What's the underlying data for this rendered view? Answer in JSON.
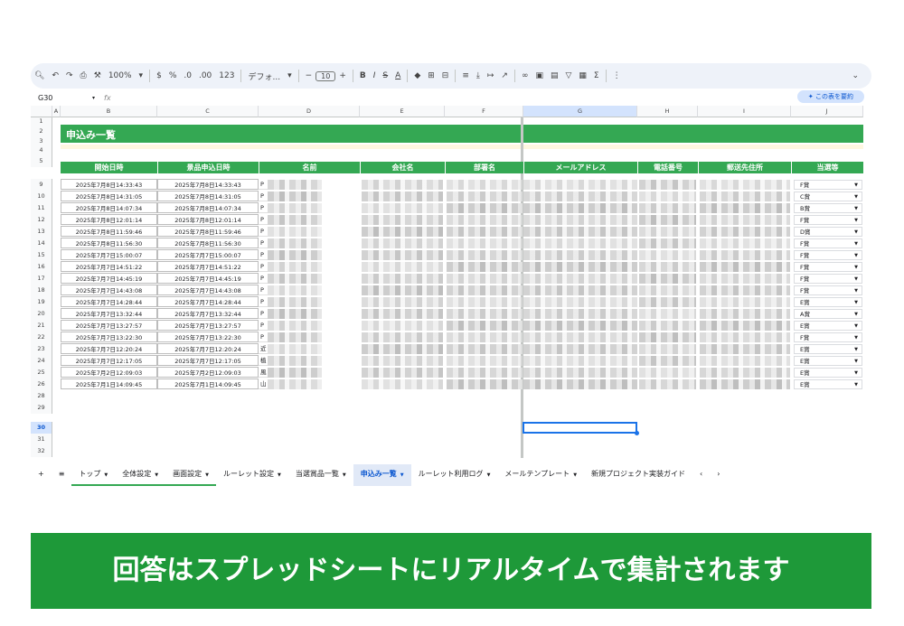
{
  "toolbar": {
    "zoom": "100%",
    "currency": "$",
    "percent": "%",
    "dec_decrease": ".0",
    "dec_increase": ".00",
    "number_format": "123",
    "font": "デフォ...",
    "font_size": "10"
  },
  "formula_bar": {
    "cell_ref": "G30",
    "fx": "fx",
    "summarize_label": "この表を要約"
  },
  "columns": [
    "A",
    "B",
    "C",
    "D",
    "E",
    "F",
    "G",
    "H",
    "I",
    "J"
  ],
  "sheet_title": "申込み一覧",
  "headers": [
    "開始日時",
    "景品申込日時",
    "名前",
    "会社名",
    "部署名",
    "メールアドレス",
    "電話番号",
    "郵送先住所",
    "当選等"
  ],
  "row_numbers": [
    "1",
    "2",
    "3",
    "4",
    "5",
    "9",
    "10",
    "11",
    "12",
    "13",
    "14",
    "15",
    "16",
    "17",
    "18",
    "19",
    "20",
    "21",
    "22",
    "23",
    "24",
    "25",
    "26",
    "28",
    "29",
    "30",
    "31",
    "32"
  ],
  "rows": [
    {
      "start": "2025年7月8日14:33:43",
      "applied": "2025年7月8日14:33:43",
      "name_initial": "P",
      "prize": "F賞"
    },
    {
      "start": "2025年7月8日14:31:05",
      "applied": "2025年7月8日14:31:05",
      "name_initial": "P",
      "prize": "C賞"
    },
    {
      "start": "2025年7月8日14:07:34",
      "applied": "2025年7月8日14:07:34",
      "name_initial": "P",
      "prize": "B賞"
    },
    {
      "start": "2025年7月8日12:01:14",
      "applied": "2025年7月8日12:01:14",
      "name_initial": "P",
      "prize": "F賞"
    },
    {
      "start": "2025年7月8日11:59:46",
      "applied": "2025年7月8日11:59:46",
      "name_initial": "P",
      "prize": "D賞"
    },
    {
      "start": "2025年7月8日11:56:30",
      "applied": "2025年7月8日11:56:30",
      "name_initial": "P",
      "prize": "F賞"
    },
    {
      "start": "2025年7月7日15:00:07",
      "applied": "2025年7月7日15:00:07",
      "name_initial": "P",
      "prize": "F賞"
    },
    {
      "start": "2025年7月7日14:51:22",
      "applied": "2025年7月7日14:51:22",
      "name_initial": "P",
      "prize": "F賞"
    },
    {
      "start": "2025年7月7日14:45:19",
      "applied": "2025年7月7日14:45:19",
      "name_initial": "P",
      "prize": "F賞"
    },
    {
      "start": "2025年7月7日14:43:08",
      "applied": "2025年7月7日14:43:08",
      "name_initial": "P",
      "prize": "F賞"
    },
    {
      "start": "2025年7月7日14:28:44",
      "applied": "2025年7月7日14:28:44",
      "name_initial": "P",
      "prize": "E賞"
    },
    {
      "start": "2025年7月7日13:32:44",
      "applied": "2025年7月7日13:32:44",
      "name_initial": "P",
      "prize": "A賞"
    },
    {
      "start": "2025年7月7日13:27:57",
      "applied": "2025年7月7日13:27:57",
      "name_initial": "P",
      "prize": "E賞"
    },
    {
      "start": "2025年7月7日13:22:30",
      "applied": "2025年7月7日13:22:30",
      "name_initial": "P",
      "prize": "F賞"
    },
    {
      "start": "2025年7月7日12:20:24",
      "applied": "2025年7月7日12:20:24",
      "name_initial": "近",
      "prize": "E賞"
    },
    {
      "start": "2025年7月7日12:17:05",
      "applied": "2025年7月7日12:17:05",
      "name_initial": "植",
      "prize": "E賞"
    },
    {
      "start": "2025年7月2日12:09:03",
      "applied": "2025年7月2日12:09:03",
      "name_initial": "風",
      "prize": "E賞"
    },
    {
      "start": "2025年7月1日14:09:45",
      "applied": "2025年7月1日14:09:45",
      "name_initial": "山",
      "prize": "E賞"
    }
  ],
  "tabs": [
    {
      "label": "トップ",
      "state": "green"
    },
    {
      "label": "全体設定",
      "state": "green"
    },
    {
      "label": "画面設定",
      "state": "green"
    },
    {
      "label": "ルーレット設定",
      "state": ""
    },
    {
      "label": "当選賞品一覧",
      "state": ""
    },
    {
      "label": "申込み一覧",
      "state": "active"
    },
    {
      "label": "ルーレット利用ログ",
      "state": ""
    },
    {
      "label": "メールテンプレート",
      "state": ""
    },
    {
      "label": "新規プロジェクト実装ガイド",
      "state": ""
    }
  ],
  "banner_text": "回答はスプレッドシートにリアルタイムで集計されます",
  "colors": {
    "green": "#34a853",
    "banner_green": "#1e9939",
    "selection_blue": "#1a73e8"
  }
}
